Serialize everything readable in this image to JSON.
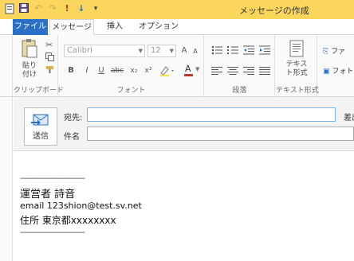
{
  "title_bar": {
    "title": "メッセージの作成",
    "quick_access": [
      {
        "icon": "new-window-icon",
        "glyph": "▢"
      },
      {
        "icon": "save-icon",
        "glyph": "▪"
      },
      {
        "icon": "undo-icon",
        "glyph": "↶"
      },
      {
        "icon": "redo-icon",
        "glyph": "↷"
      },
      {
        "icon": "high-importance-icon",
        "glyph": "!"
      },
      {
        "icon": "low-importance-icon",
        "glyph": "↓"
      },
      {
        "icon": "customize-chevron-icon",
        "glyph": "▾"
      }
    ]
  },
  "tabs": {
    "file": "ファイル",
    "message": "メッセージ",
    "insert": "挿入",
    "options": "オプション"
  },
  "ribbon": {
    "clipboard": {
      "paste_label": "貼り付け",
      "group_label": "クリップボード"
    },
    "font": {
      "font_name": "Calibri",
      "font_size": "12",
      "bold": "B",
      "italic": "I",
      "underline": "U",
      "strike": "abc",
      "subscript": "x₂",
      "superscript": "x²",
      "font_color": "A",
      "group_label": "フォント"
    },
    "paragraph": {
      "group_label": "段落"
    },
    "text_format": {
      "button_label": "テキスト形式",
      "group_label": "テキスト形式"
    },
    "include": {
      "file_label": "ファ",
      "photo_label": "フォト"
    }
  },
  "compose": {
    "send_label": "送信",
    "to_label": "宛先:",
    "cc_label": "差出",
    "subject_label": "件名",
    "to_value": "",
    "subject_value": ""
  },
  "body": {
    "lines": [
      "-------------------------------",
      "運営者  詩音",
      "email   123shion@test.sv.net",
      "住所     東京都xxxxxxxx",
      "-------------------------------"
    ]
  },
  "colors": {
    "title_bar": "#fbd65d",
    "file_tab": "#2b6fc6",
    "accent_blue": "#2b6fc6"
  }
}
